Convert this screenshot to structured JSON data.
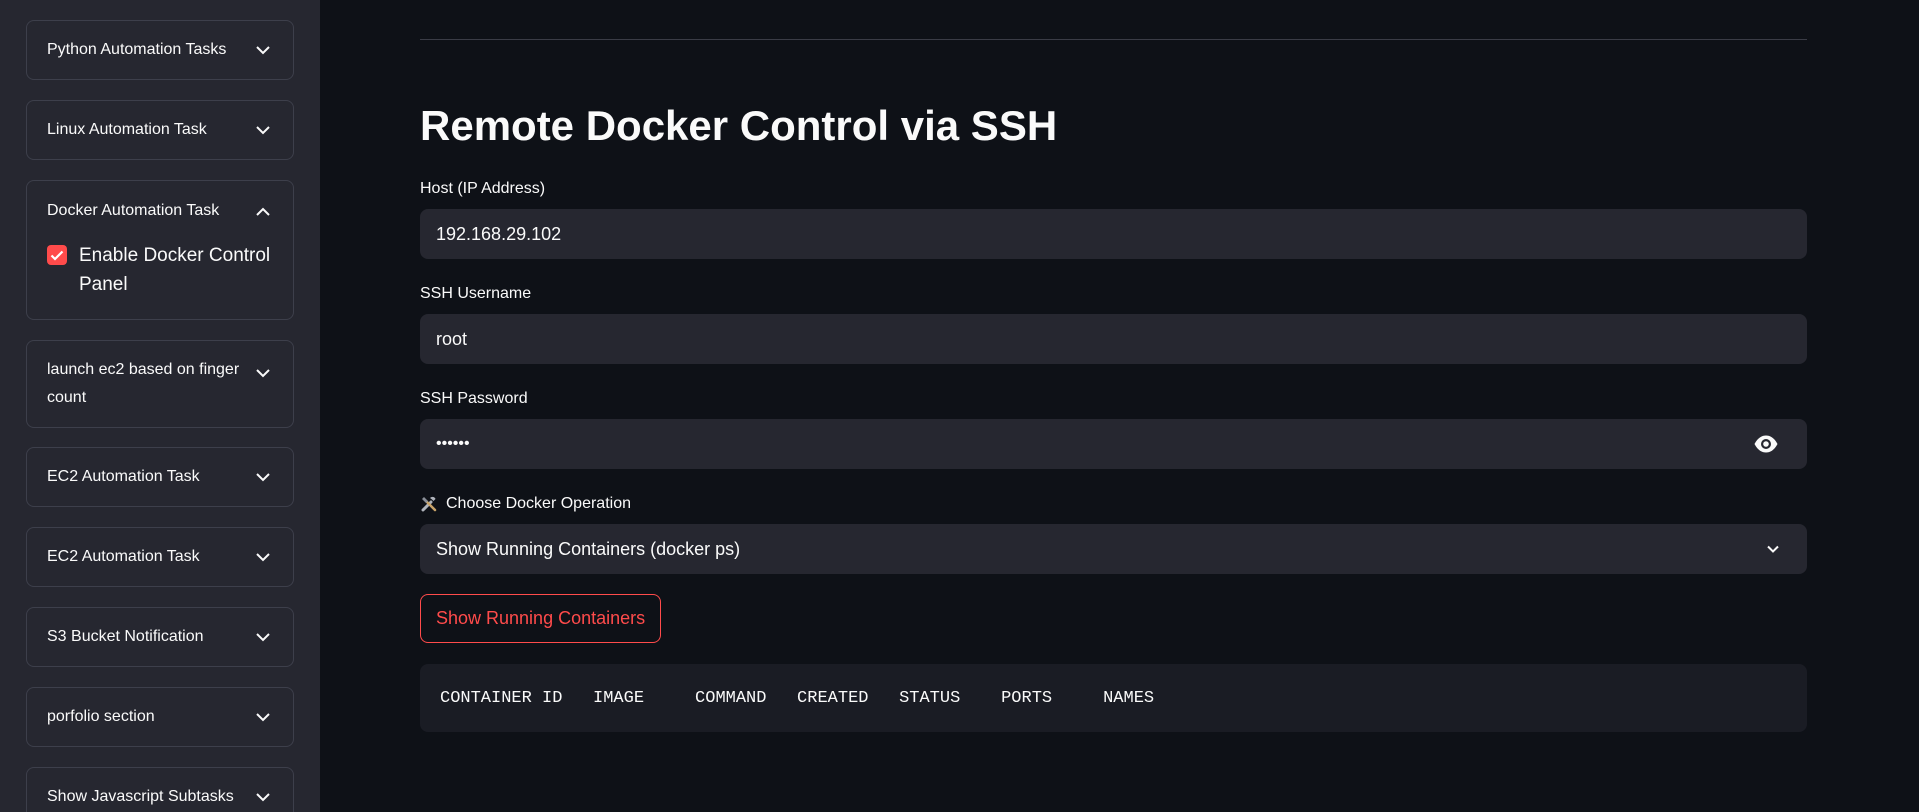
{
  "sidebar": {
    "items": [
      {
        "label": "Python Automation Tasks",
        "expanded": false
      },
      {
        "label": "Linux Automation Task",
        "expanded": false
      },
      {
        "label": "Docker Automation Task",
        "expanded": true,
        "checkbox": {
          "label": "Enable Docker Control Panel",
          "checked": true
        }
      },
      {
        "label": "launch ec2 based on finger count",
        "expanded": false
      },
      {
        "label": "EC2 Automation Task",
        "expanded": false
      },
      {
        "label": "EC2 Automation Task",
        "expanded": false
      },
      {
        "label": "S3 Bucket Notification",
        "expanded": false
      },
      {
        "label": "porfolio section",
        "expanded": false
      },
      {
        "label": "Show Javascript Subtasks",
        "expanded": false
      }
    ]
  },
  "main": {
    "title": "Remote Docker Control via SSH",
    "host": {
      "label": "Host (IP Address)",
      "value": "192.168.29.102"
    },
    "username": {
      "label": "SSH Username",
      "value": "root"
    },
    "password": {
      "label": "SSH Password",
      "value": "••••••",
      "icon": "eye-icon"
    },
    "operation": {
      "label": "Choose Docker Operation",
      "icon": "tools-icon",
      "selected": "Show Running Containers (docker ps)"
    },
    "button_label": "Show Running Containers",
    "output": "CONTAINER ID   IMAGE     COMMAND   CREATED   STATUS    PORTS     NAMES"
  },
  "colors": {
    "background": "#0e1117",
    "sidebar": "#262730",
    "accent": "#ff4b4b",
    "input": "#262730",
    "text": "#fafafa"
  }
}
